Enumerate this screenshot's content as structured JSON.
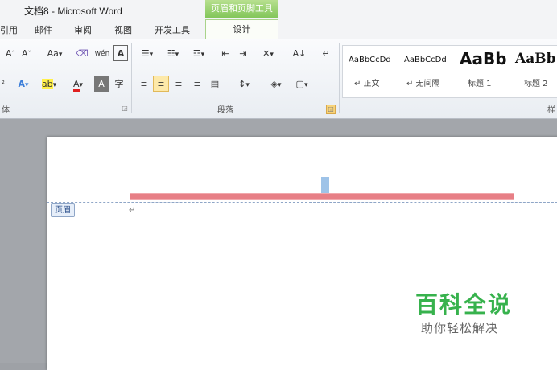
{
  "window": {
    "title": "文档8 - Microsoft Word",
    "context_tab_header": "页眉和页脚工具"
  },
  "tabs": [
    {
      "label": "引用"
    },
    {
      "label": "邮件"
    },
    {
      "label": "审阅"
    },
    {
      "label": "视图"
    },
    {
      "label": "开发工具"
    },
    {
      "label": "设计"
    }
  ],
  "ribbon": {
    "font_group": {
      "label": "体",
      "row1": {
        "grow": "A",
        "shrink": "A",
        "change_case": "Aa",
        "phonetic": "wén",
        "char_border": "A"
      },
      "row2": {
        "effects": "A",
        "highlight": "ab",
        "font_color": "A",
        "char_shading": "A",
        "enclose": "字"
      }
    },
    "paragraph_group": {
      "label": "段落",
      "sort": "A↓",
      "show_marks": "↵"
    },
    "styles_group": {
      "label": "样",
      "items": [
        {
          "sample": "AaBbCcDd",
          "name": "↵ 正文"
        },
        {
          "sample": "AaBbCcDd",
          "name": "↵ 无间隔"
        },
        {
          "sample": "AaBb",
          "name": "标题 1"
        },
        {
          "sample": "AaBb(",
          "name": "标题 2"
        }
      ]
    }
  },
  "document": {
    "header_tag": "页眉",
    "paragraph_mark": "↵"
  },
  "watermark": {
    "title": "百科全说",
    "subtitle": "助你轻松解决"
  },
  "colors": {
    "context_tab": "#83c65a",
    "header_rule": "#e77f86",
    "watermark": "#37b24d"
  }
}
